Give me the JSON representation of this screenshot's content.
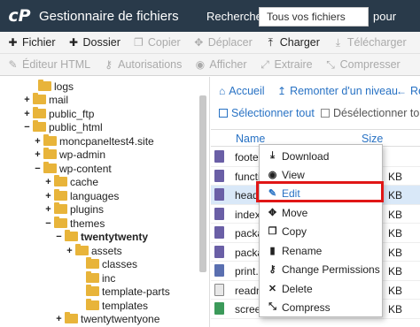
{
  "header": {
    "logo": "cP",
    "title": "Gestionnaire de fichiers",
    "search_label": "Rechercher",
    "search_value": "Tous vos fichiers",
    "for_label": "pour"
  },
  "toolbar1": {
    "file": "Fichier",
    "folder": "Dossier",
    "copy": "Copier",
    "move": "Déplacer",
    "upload": "Charger",
    "download": "Télécharger"
  },
  "toolbar2": {
    "html_editor": "Éditeur HTML",
    "permissions": "Autorisations",
    "view": "Afficher",
    "extract": "Extraire",
    "compress": "Compresser"
  },
  "tree": {
    "items": [
      {
        "label": "logs",
        "toggle": ""
      },
      {
        "label": "mail",
        "toggle": "+"
      },
      {
        "label": "public_ftp",
        "toggle": "+"
      },
      {
        "label": "public_html",
        "toggle": "−"
      },
      {
        "label": "moncpaneltest4.site",
        "toggle": "+"
      },
      {
        "label": "wp-admin",
        "toggle": "+"
      },
      {
        "label": "wp-content",
        "toggle": "−"
      },
      {
        "label": "cache",
        "toggle": "+"
      },
      {
        "label": "languages",
        "toggle": "+"
      },
      {
        "label": "plugins",
        "toggle": "+"
      },
      {
        "label": "themes",
        "toggle": "−"
      },
      {
        "label": "twentytwenty",
        "toggle": "−"
      },
      {
        "label": "assets",
        "toggle": "+"
      },
      {
        "label": "classes",
        "toggle": ""
      },
      {
        "label": "inc",
        "toggle": ""
      },
      {
        "label": "template-parts",
        "toggle": ""
      },
      {
        "label": "templates",
        "toggle": ""
      },
      {
        "label": "twentytwentyone",
        "toggle": "+"
      }
    ]
  },
  "nav": {
    "home": "Accueil",
    "up": "Remonter d'un niveau",
    "back": "Re",
    "select_all": "Sélectionner tout",
    "deselect_all": "Désélectionner tout"
  },
  "table": {
    "col_name": "Name",
    "col_size": "Size",
    "rows": [
      {
        "name": "foote",
        "size": ""
      },
      {
        "name": "functi",
        "size": "KB"
      },
      {
        "name": "heade",
        "size": "KB"
      },
      {
        "name": "index",
        "size": "KB"
      },
      {
        "name": "packa",
        "size": "KB"
      },
      {
        "name": "packa",
        "size": "KB"
      },
      {
        "name": "print.c",
        "size": "KB"
      },
      {
        "name": "readm",
        "size": "KB"
      },
      {
        "name": "scree",
        "size": "KB"
      }
    ]
  },
  "context_menu": {
    "download": "Download",
    "view": "View",
    "edit": "Edit",
    "move": "Move",
    "copy": "Copy",
    "rename": "Rename",
    "change_permissions": "Change Permissions",
    "delete": "Delete",
    "compress": "Compress"
  },
  "colors": {
    "header_bg": "#293a4a",
    "link": "#2872c4",
    "highlight_border": "#e01616",
    "folder": "#e8b43a"
  }
}
